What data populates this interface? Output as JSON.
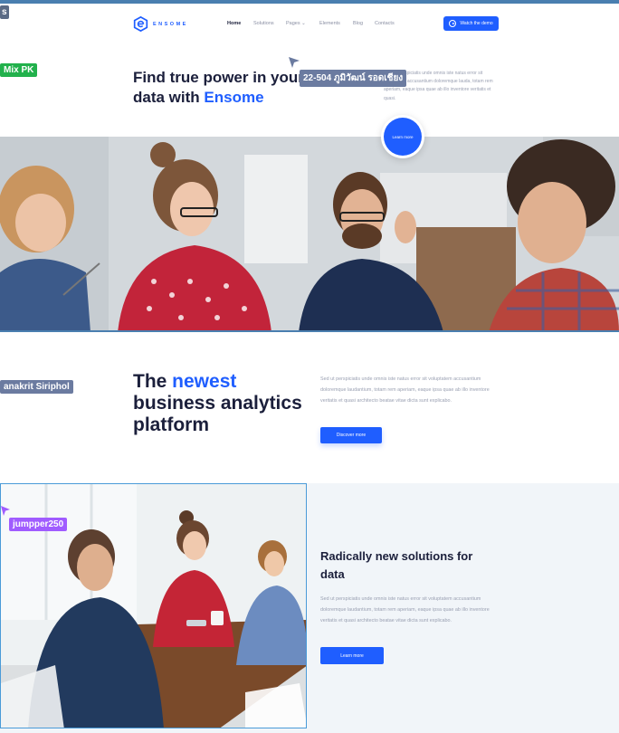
{
  "brand": {
    "name": "ENSOME"
  },
  "nav": {
    "items": [
      {
        "label": "Home",
        "active": true
      },
      {
        "label": "Solutions",
        "active": false
      },
      {
        "label": "Pages",
        "active": false
      },
      {
        "label": "Elements",
        "active": false
      },
      {
        "label": "Blog",
        "active": false
      },
      {
        "label": "Contacts",
        "active": false
      }
    ],
    "cta_label": "Watch the demo"
  },
  "hero": {
    "title_part1": "Find true power in your",
    "title_part2": "data with ",
    "title_accent": "Ensome",
    "body": "Sed ut perspiciatis unde omnis iste natus error sit voluptatem accusantium doloremque lauda, totam rem aperiam, eaque ipsa quae ab illo inventore veritatis et quasi.",
    "circle_button": "Learn more"
  },
  "section2": {
    "title_prefix": "The ",
    "title_accent": "newest",
    "title_rest": "business analytics platform",
    "body": "Sed ut perspiciatis unde omnis iste natus error sit voluptatem accusantium doloremque laudantium, totam rem aperiam, eaque ipsa quae ab illo inventore veritatis et quasi architecto beatae vitae dicta sunt explicabo.",
    "button": "Discover more"
  },
  "section3": {
    "title": "Radically new solutions for data",
    "body": "Sed ut perspiciatis unde omnis iste natus error sit voluptatem accusantium doloremque laudantium, totam rem aperiam, eaque ipsa quae ab illo inventore veritatis et quasi architecto beatae vitae dicta sunt explicabo.",
    "button": "Learn more"
  },
  "collaborators": [
    {
      "name": "s",
      "color": "#5b6b85"
    },
    {
      "name": "Mix PK",
      "color": "#22b14c"
    },
    {
      "name": "22-504 ภูมิวัฒน์ รอดเชียง",
      "color": "#6b7ba0"
    },
    {
      "name": "anakrit Siriphol",
      "color": "#6b7ba0"
    },
    {
      "name": "jumpper250",
      "color": "#a05cff"
    }
  ],
  "colors": {
    "accent": "#1f5eff",
    "text": "#1b1f3b",
    "muted": "#9aa0b2",
    "section_bg": "#f1f5f9"
  }
}
